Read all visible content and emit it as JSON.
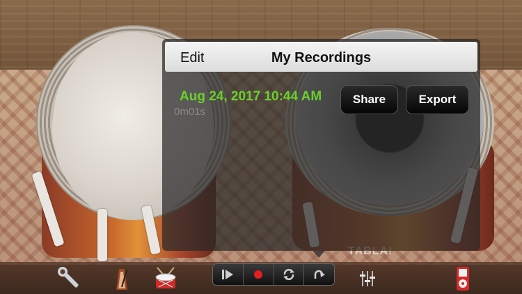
{
  "panel": {
    "edit_label": "Edit",
    "title": "My Recordings"
  },
  "recordings": [
    {
      "date": "Aug 24, 2017 10:44 AM",
      "duration": "0m01s",
      "share_label": "Share",
      "export_label": "Export"
    }
  ],
  "background": {
    "brand_text": "TABLA!"
  },
  "toolbar": {
    "icons": [
      "wrench-icon",
      "metronome-icon",
      "drum-icon",
      "play-icon",
      "record-icon",
      "loop-icon",
      "redo-icon",
      "mixer-icon",
      "ipod-icon"
    ]
  },
  "colors": {
    "accent_green": "#6ad12a",
    "record_red": "#e02020"
  }
}
